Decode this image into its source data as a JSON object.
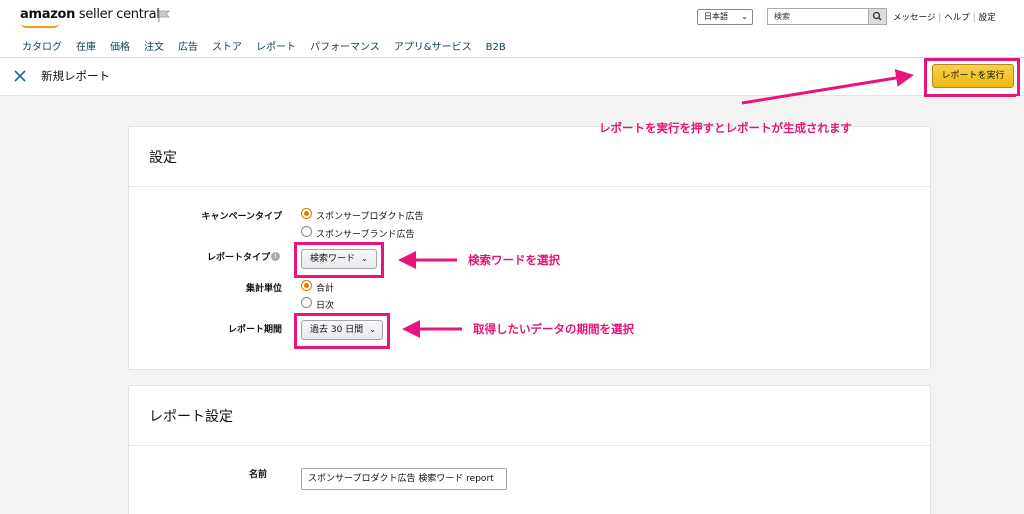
{
  "header": {
    "logo_bold": "amazon",
    "logo_light": " seller central",
    "language": "日本語",
    "search_placeholder": "検索",
    "links": [
      "メッセージ",
      "ヘルプ",
      "設定"
    ],
    "nav": [
      "カタログ",
      "在庫",
      "価格",
      "注文",
      "広告",
      "ストア",
      "レポート",
      "パフォーマンス",
      "アプリ&サービス",
      "B2B"
    ]
  },
  "subheader": {
    "title": "新規レポート",
    "run_button": "レポートを実行"
  },
  "annotations": {
    "run_note": "レポートを実行を押すとレポートが生成されます",
    "type_note": "検索ワードを選択",
    "period_note": "取得したいデータの期間を選択"
  },
  "settings": {
    "title": "設定",
    "campaign_type_label": "キャンペーンタイプ",
    "campaign_options": [
      "スポンサープロダクト広告",
      "スポンサーブランド広告"
    ],
    "campaign_selected": "スポンサープロダクト広告",
    "report_type_label": "レポートタイプ",
    "report_type_value": "検索ワード",
    "aggregation_label": "集計単位",
    "aggregation_options": [
      "合計",
      "日次"
    ],
    "aggregation_selected": "合計",
    "period_label": "レポート期間",
    "period_value": "過去 30 日間"
  },
  "report_settings": {
    "title": "レポート設定",
    "name_label": "名前",
    "name_value": "スポンサープロダクト広告 検索ワード report"
  },
  "colors": {
    "annotation": "#e7157b",
    "run_button": "#f0b90e",
    "radio_selected": "#e77600"
  }
}
